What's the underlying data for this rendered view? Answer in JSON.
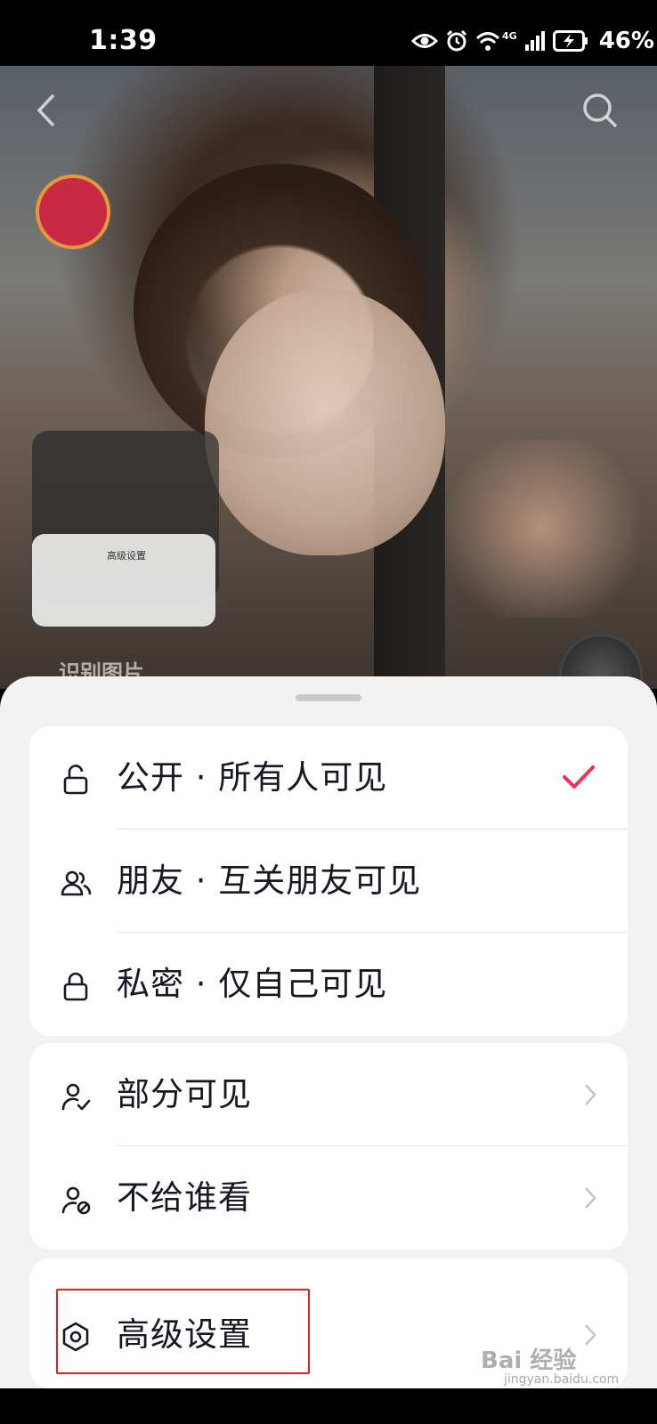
{
  "status_bar": {
    "time": "1:39",
    "battery_percent": "46%",
    "network_label": "4G",
    "icons": [
      "eye-icon",
      "alarm-icon",
      "wifi-icon",
      "signal-icon",
      "battery-charging-icon"
    ]
  },
  "background": {
    "preview_card_title": "高级设置",
    "ocr_hint": "识别图片"
  },
  "visibility_group": [
    {
      "icon": "unlock-icon",
      "label": "公开 · 所有人可见",
      "selected": true
    },
    {
      "icon": "friends-icon",
      "label": "朋友 · 互关朋友可见",
      "selected": false
    },
    {
      "icon": "lock-icon",
      "label": "私密 · 仅自己可见",
      "selected": false
    }
  ],
  "partial_group": [
    {
      "icon": "user-check-icon",
      "label": "部分可见"
    },
    {
      "icon": "user-block-icon",
      "label": "不给谁看"
    }
  ],
  "advanced_group": [
    {
      "icon": "hexagon-settings-icon",
      "label": "高级设置"
    }
  ],
  "colors": {
    "accent": "#fe2c55",
    "highlight_box": "#e02020",
    "sheet_bg": "#f2f2f2",
    "card_bg": "#ffffff",
    "text": "#161823"
  },
  "watermark": {
    "main": "Bai 经验",
    "sub": "jingyan.baidu.com"
  }
}
